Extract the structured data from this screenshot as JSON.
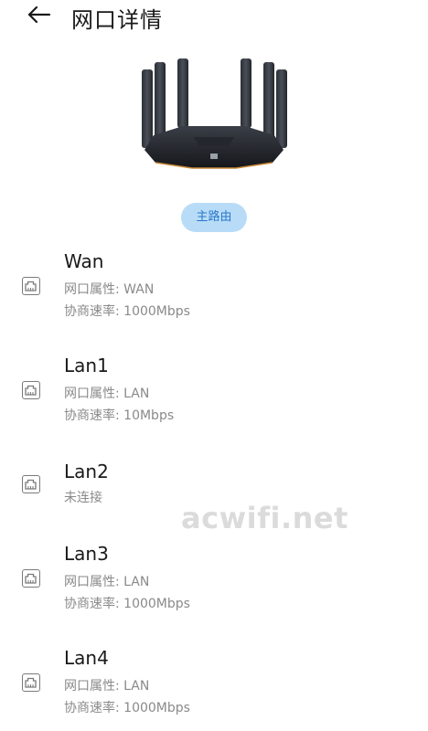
{
  "header": {
    "title": "网口详情",
    "back_icon": "arrow-left-icon"
  },
  "device": {
    "image": "router-image",
    "role_badge": "主路由"
  },
  "ports": [
    {
      "name": "Wan",
      "lines": [
        "网口属性: WAN",
        "协商速率: 1000Mbps"
      ]
    },
    {
      "name": "Lan1",
      "lines": [
        "网口属性: LAN",
        "协商速率: 10Mbps"
      ]
    },
    {
      "name": "Lan2",
      "lines": [
        "未连接"
      ]
    },
    {
      "name": "Lan3",
      "lines": [
        "网口属性: LAN",
        "协商速率: 1000Mbps"
      ]
    },
    {
      "name": "Lan4",
      "lines": [
        "网口属性: LAN",
        "协商速率: 1000Mbps"
      ]
    }
  ],
  "watermark": "acwifi.net",
  "colors": {
    "badge_bg": "#b8dcf8",
    "badge_text": "#2a78c8",
    "secondary_text": "#8a8a8a"
  }
}
